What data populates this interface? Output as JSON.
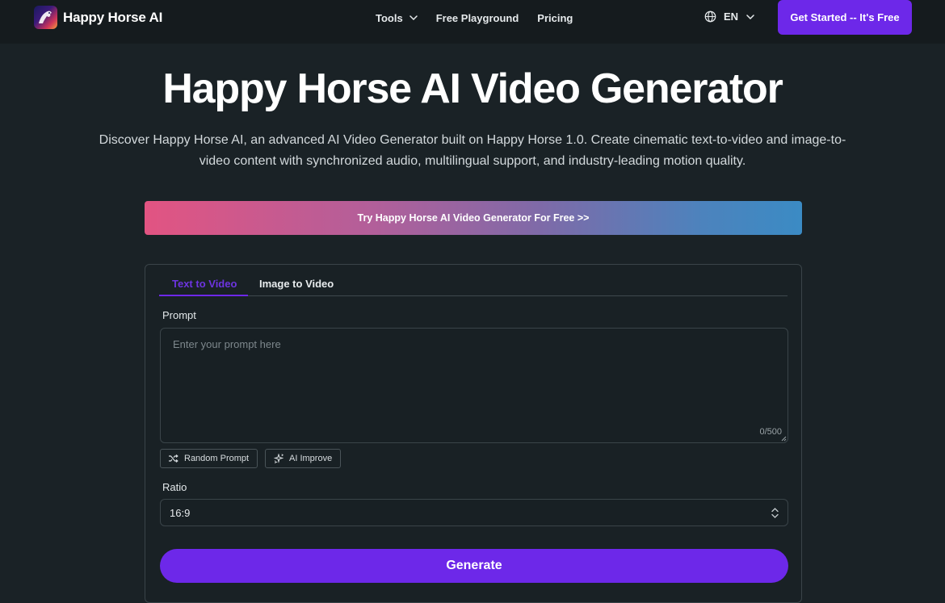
{
  "nav": {
    "brand": "Happy Horse AI",
    "links": [
      {
        "label": "Tools"
      },
      {
        "label": "Free Playground"
      },
      {
        "label": "Pricing"
      }
    ],
    "language": "EN",
    "cta_label": "Get Started -- It's Free"
  },
  "hero": {
    "title": "Happy Horse AI Video Generator",
    "description": "Discover Happy Horse AI, an advanced AI Video Generator built on Happy Horse 1.0. Create cinematic text-to-video and image-to-video content with synchronized audio, multilingual support, and industry-leading motion quality.",
    "banner_label": "Try Happy Horse AI Video Generator For Free >>"
  },
  "generator": {
    "tabs": [
      {
        "label": "Text to Video",
        "active": true
      },
      {
        "label": "Image to Video",
        "active": false
      }
    ],
    "prompt_label": "Prompt",
    "prompt_placeholder": "Enter your prompt here",
    "prompt_value": "",
    "char_count": "0/500",
    "random_prompt_label": "Random Prompt",
    "ai_improve_label": "AI Improve",
    "ratio_label": "Ratio",
    "ratio_value": "16:9",
    "generate_label": "Generate"
  },
  "colors": {
    "accent": "#6d28e9",
    "background": "#1a2226",
    "banner_gradient_start": "#e25482",
    "banner_gradient_end": "#3b8bc4"
  },
  "icons": {
    "logo": "horse-logo-icon",
    "tools_chevron": "chevron-down-icon",
    "language": "globe-icon",
    "random_prompt": "shuffle-icon",
    "ai_improve": "sparkles-icon",
    "ratio_select": "chevron-up-down-icon"
  }
}
